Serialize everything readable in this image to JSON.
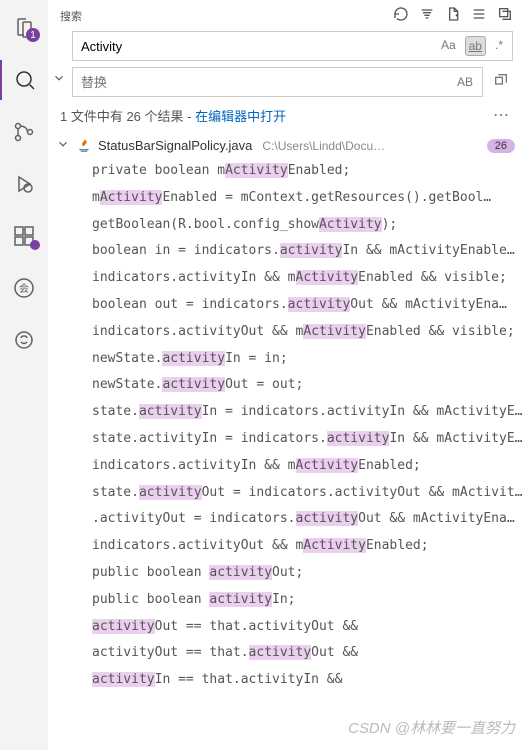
{
  "activityBar": {
    "explorerBadge": "1"
  },
  "search": {
    "title": "搜索",
    "query": "Activity",
    "replacePlaceholder": "替换",
    "options": {
      "caseSensitive": "Aa",
      "wholeWord": "ab",
      "regex": ".*",
      "preserveCase": "AB"
    }
  },
  "summary": {
    "textPrefix": "1 文件中有 26 个结果 - ",
    "openLink": "在编辑器中打开"
  },
  "file": {
    "name": "StatusBarSignalPolicy.java",
    "path": "C:\\Users\\Lindd\\Docu…",
    "count": "26"
  },
  "matches": [
    {
      "pre": "private boolean m",
      "hl": "Activity",
      "post": "Enabled;"
    },
    {
      "pre": "m",
      "hl": "Activity",
      "post": "Enabled = mContext.getResources().getBool…"
    },
    {
      "pre": "getBoolean(R.bool.config_show",
      "hl": "Activity",
      "post": ");"
    },
    {
      "pre": "boolean in = indicators.",
      "hl": "activity",
      "post": "In && mActivityEnable…"
    },
    {
      "pre": "indicators.activityIn && m",
      "hl": "Activity",
      "post": "Enabled && visible;"
    },
    {
      "pre": "boolean out = indicators.",
      "hl": "activity",
      "post": "Out && mActivityEna…"
    },
    {
      "pre": "indicators.activityOut && m",
      "hl": "Activity",
      "post": "Enabled && visible;"
    },
    {
      "pre": "newState.",
      "hl": "activity",
      "post": "In = in;"
    },
    {
      "pre": "newState.",
      "hl": "activity",
      "post": "Out = out;"
    },
    {
      "pre": "state.",
      "hl": "activity",
      "post": "In = indicators.activityIn && mActivityEna…"
    },
    {
      "pre": "state.activityIn = indicators.",
      "hl": "activity",
      "post": "In && mActivityEna…"
    },
    {
      "pre": "indicators.activityIn && m",
      "hl": "Activity",
      "post": "Enabled;"
    },
    {
      "pre": "state.",
      "hl": "activity",
      "post": "Out = indicators.activityOut && mActivity…"
    },
    {
      "pre": ".activityOut = indicators.",
      "hl": "activity",
      "post": "Out && mActivityEna…"
    },
    {
      "pre": "indicators.activityOut && m",
      "hl": "Activity",
      "post": "Enabled;"
    },
    {
      "pre": "public boolean ",
      "hl": "activity",
      "post": "Out;"
    },
    {
      "pre": "public boolean ",
      "hl": "activity",
      "post": "In;"
    },
    {
      "pre": "",
      "hl": "activity",
      "post": "Out == that.activityOut &&"
    },
    {
      "pre": "activityOut == that.",
      "hl": "activity",
      "post": "Out &&"
    },
    {
      "pre": "",
      "hl": "activity",
      "post": "In == that.activityIn &&"
    }
  ],
  "watermark": "CSDN @林林要一直努力"
}
